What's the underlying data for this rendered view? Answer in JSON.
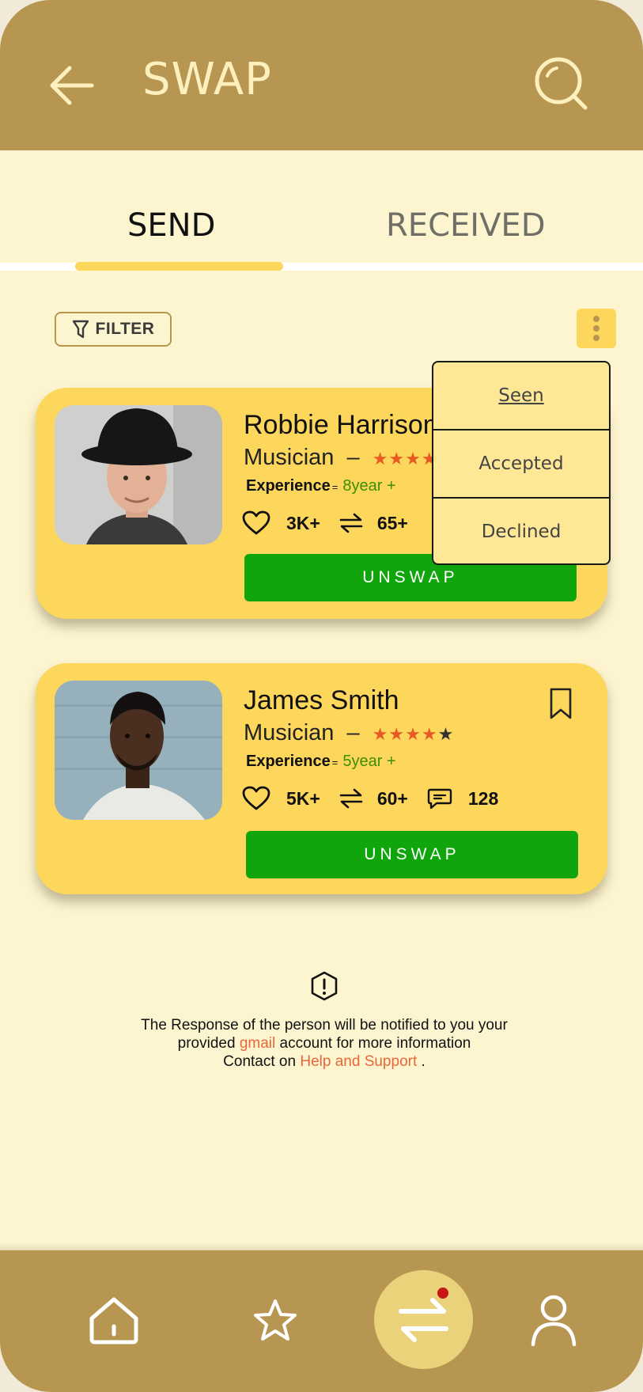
{
  "header": {
    "title": "SWAP",
    "back_icon": "arrow-left-icon",
    "search_icon": "search-icon"
  },
  "tabs": [
    {
      "label": "SEND",
      "active": true
    },
    {
      "label": "RECEIVED",
      "active": false
    }
  ],
  "filter": {
    "label": "FILTER",
    "icon": "filter-icon"
  },
  "menu": {
    "icon": "more-vertical-icon",
    "options": [
      {
        "label": "Seen"
      },
      {
        "label": "Accepted"
      },
      {
        "label": "Declined"
      }
    ]
  },
  "cards": [
    {
      "name": "Robbie Harrison",
      "role": "Musician",
      "dash": "–",
      "rating": 4,
      "rating_max": 5,
      "stars": "★★★★",
      "stars_off": "★",
      "experience_label": "Experience",
      "experience_sep": "=",
      "experience_value": "8year +",
      "likes": "3K+",
      "swaps": "65+",
      "comments": "",
      "button": "UNSWAP"
    },
    {
      "name": "James Smith",
      "role": "Musician",
      "dash": "–",
      "rating": 4,
      "rating_max": 5,
      "stars": "★★★★",
      "stars_off": "★",
      "experience_label": "Experience",
      "experience_sep": "=",
      "experience_value": "5year +",
      "likes": "5K+",
      "swaps": "60+",
      "comments": "128",
      "button": "UNSWAP"
    }
  ],
  "notice": {
    "line1": "The Response of the person will be notified to you your",
    "line2_pre": "provided",
    "line2_link": "gmail",
    "line2_post": "account for more information",
    "line3_pre": "Contact on",
    "line3_link": "Help and Support",
    "line3_post": "."
  },
  "bottom_nav": {
    "items": [
      "home-icon",
      "star-icon",
      "swap-icon",
      "user-icon"
    ],
    "active": "swap-icon"
  },
  "colors": {
    "header": "#b79651",
    "background": "#fdf5d0",
    "card": "#fdd65c",
    "button": "#10a50c",
    "star": "#e85a24",
    "link": "#e8673a",
    "experience": "#3e8e05",
    "notification": "#c71414"
  }
}
